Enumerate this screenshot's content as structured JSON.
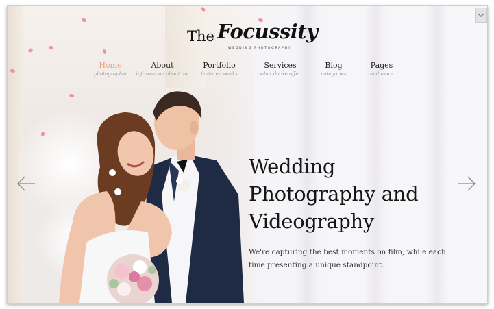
{
  "logo": {
    "prefix": "The",
    "name": "Focussity",
    "tagline": "WEDDING PHOTOGRAPHY"
  },
  "nav": [
    {
      "label": "Home",
      "sub": "photographer",
      "active": true
    },
    {
      "label": "About",
      "sub": "information about me"
    },
    {
      "label": "Portfolio",
      "sub": "featured works"
    },
    {
      "label": "Services",
      "sub": "what do we offer"
    },
    {
      "label": "Blog",
      "sub": "categories"
    },
    {
      "label": "Pages",
      "sub": "and more"
    }
  ],
  "hero": {
    "title_lines": [
      "Wedding",
      "Photography and",
      "Videography"
    ],
    "text_lines": [
      "We're capturing the best moments on film, while each",
      "time presenting a unique standpoint."
    ]
  },
  "slider": {
    "prev_icon": "arrow-left-icon",
    "next_icon": "arrow-right-icon"
  },
  "colors": {
    "active_nav": "#e9a484",
    "suit": "#1f2a44",
    "hair": "#6b3b22"
  }
}
